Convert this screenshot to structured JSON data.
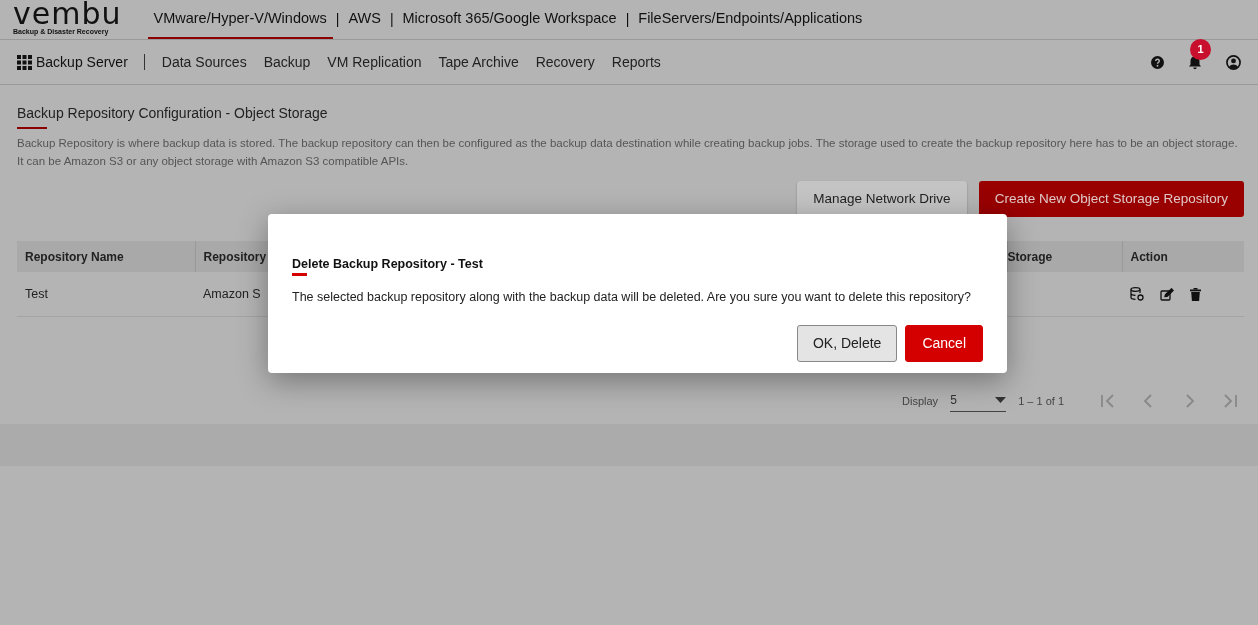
{
  "logo": {
    "brand": "vembu",
    "tagline": "Backup & Disaster Recovery"
  },
  "tab_separator": "|",
  "product_tabs": [
    {
      "label": "VMware/Hyper-V/Windows",
      "selected": true
    },
    {
      "label": "AWS",
      "selected": false
    },
    {
      "label": "Microsoft 365/Google Workspace",
      "selected": false
    },
    {
      "label": "FileServers/Endpoints/Applications",
      "selected": false
    }
  ],
  "nav": {
    "app": "Backup Server",
    "items": [
      "Data Sources",
      "Backup",
      "VM Replication",
      "Tape Archive",
      "Recovery",
      "Reports"
    ],
    "notification_count": "1"
  },
  "page": {
    "title": "Backup Repository Configuration - Object Storage",
    "description": "Backup Repository is where backup data is stored. The backup repository can then be configured as the backup data destination while creating backup jobs. The storage used to create the backup repository here has to be an object storage. It can be Amazon S3 or any object storage with Amazon S3 compatible APIs.",
    "buttons": [
      {
        "label": "Manage Network Drive",
        "kind": "secondary"
      },
      {
        "label": "Create New Object Storage Repository",
        "kind": "primary"
      }
    ]
  },
  "table": {
    "columns": [
      "Repository Name",
      "Repository",
      "Storage",
      "Action"
    ],
    "rows": [
      {
        "cells": [
          "Test",
          "Amazon S",
          ""
        ]
      }
    ]
  },
  "pagination": {
    "display_label": "Display",
    "page_size": "5",
    "range": "1 – 1 of 1"
  },
  "dialog": {
    "title": "Delete Backup Repository - Test",
    "message": "The selected backup repository along with the backup data will be deleted. Are you sure you want to delete this repository?",
    "buttons": [
      {
        "label": "OK, Delete",
        "kind": "secondary"
      },
      {
        "label": "Cancel",
        "kind": "primary"
      }
    ]
  }
}
